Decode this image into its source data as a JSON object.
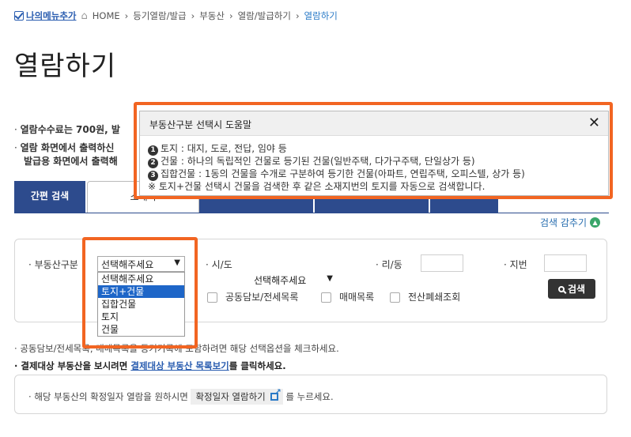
{
  "breadcrumb": {
    "favorite": "나의메뉴추가",
    "home": "HOME",
    "items": [
      "등기열람/발급",
      "부동산",
      "열람/발급하기"
    ],
    "current": "열람하기"
  },
  "title": "열람하기",
  "notices": [
    {
      "text": "열람수수료는 700원, 발"
    },
    {
      "text": "열람 화면에서 출력하신"
    },
    {
      "text": "발급용 화면에서 출력해"
    }
  ],
  "tabs": {
    "simple": "간편 검색",
    "address": "소재지"
  },
  "collapse_label": "검색 감추기",
  "form": {
    "type_label": "부동산구분",
    "type_value": "선택해주세요",
    "sido_label": "시/도",
    "sido_value": "선택해주세요",
    "ri_label": "리/동",
    "jibun_label": "지번",
    "search_button": "검색",
    "options": [
      "선택해주세요",
      "토지+건물",
      "집합건물",
      "토지",
      "건물"
    ],
    "checks": [
      "공동담보/전세목록",
      "매매목록",
      "전산폐쇄조회"
    ]
  },
  "notes": {
    "line1": "공동담보/전세목록, 매매목록을 등기기록에 포함하려면 해당 선택옵션을 체크하세요.",
    "line2_prefix": "결제대상 부동산을 보시려면",
    "line2_link": "결제대상 부동산 목록보기",
    "line2_suffix": "를 클릭하세요."
  },
  "confirm_box": {
    "prefix": "해당 부동산의 확정일자 열람을 원하시면",
    "button": "확정일자 열람하기",
    "suffix": "를 누르세요."
  },
  "help": {
    "title": "부동산구분 선택시 도움말",
    "items": [
      {
        "num": "1",
        "text": "토지 : 대지, 도로, 전답, 임야 등"
      },
      {
        "num": "2",
        "text": "건물 : 하나의 독립적인 건물로 등기된 건물(일반주택, 다가구주택, 단일상가 등)"
      },
      {
        "num": "3",
        "text": "집합건물 : 1동의 건물을 수개로 구분하여 등기한 건물(아파트, 연립주택, 오피스텔, 상가 등)"
      }
    ],
    "footnote": "※ 토지+건물 선택시 건물을 검색한 후 같은 소재지번의 토지를 자동으로 검색합니다."
  },
  "colors": {
    "highlight": "#f26522",
    "tab_active": "#2d4b8d",
    "option_selected": "#1e66c8"
  }
}
